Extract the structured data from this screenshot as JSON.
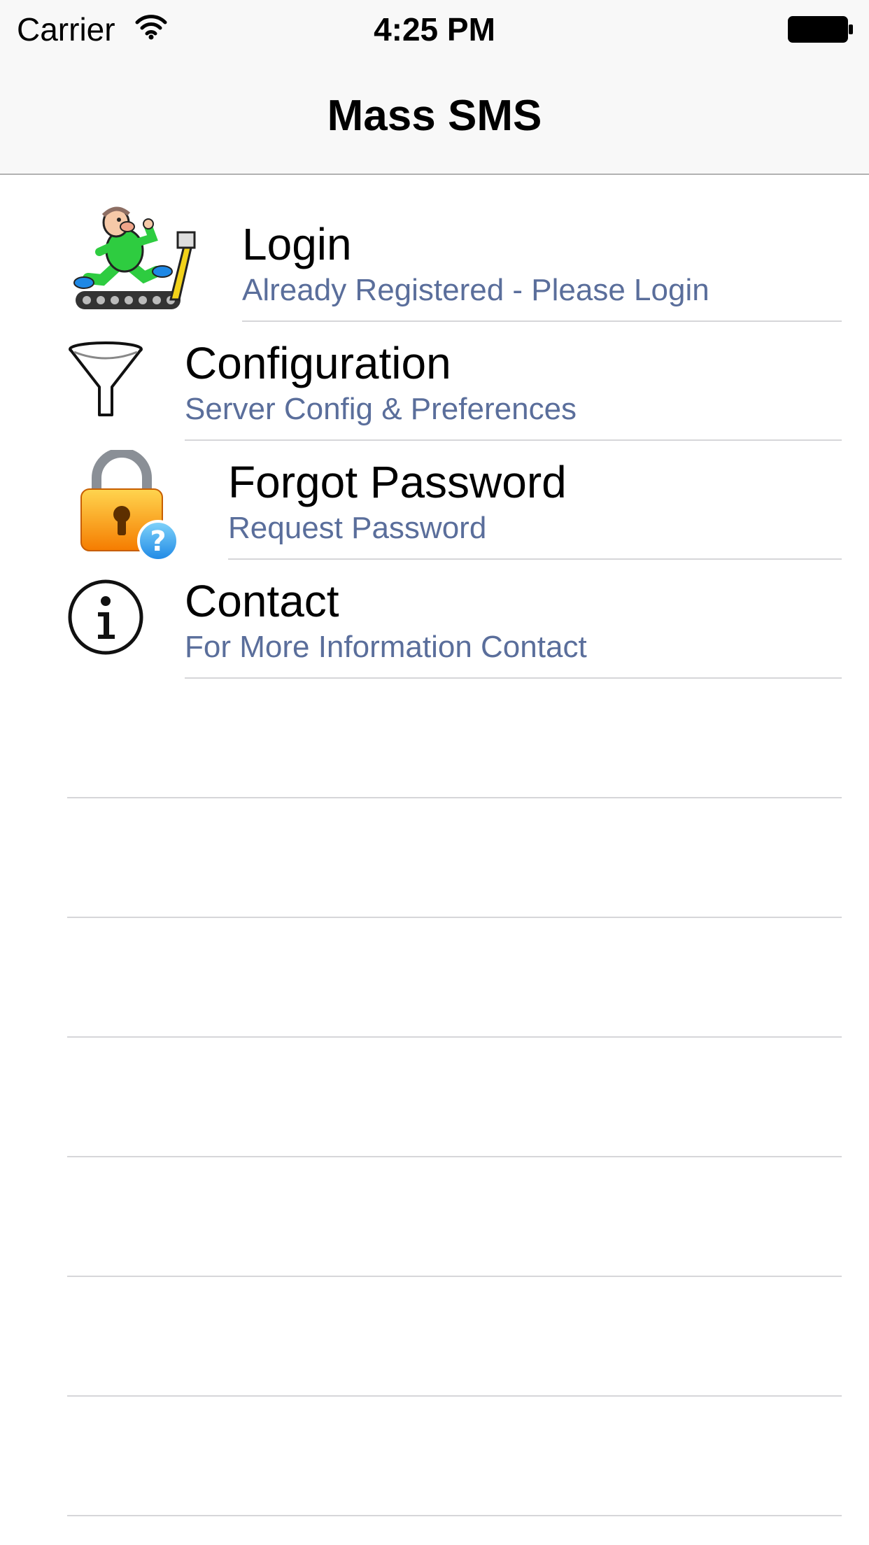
{
  "status_bar": {
    "carrier": "Carrier",
    "time": "4:25 PM",
    "icons": [
      "wifi-icon",
      "battery-icon"
    ]
  },
  "nav": {
    "title": "Mass SMS"
  },
  "menu": {
    "items": [
      {
        "icon": "runner-treadmill-icon",
        "title": "Login",
        "subtitle": "Already Registered - Please Login"
      },
      {
        "icon": "funnel-icon",
        "title": "Configuration",
        "subtitle": "Server Config & Preferences"
      },
      {
        "icon": "padlock-question-icon",
        "title": "Forgot Password",
        "subtitle": "Request Password"
      },
      {
        "icon": "info-icon",
        "title": "Contact",
        "subtitle": "For More Information Contact"
      }
    ]
  },
  "colors": {
    "subtitle": "#5a6e9b",
    "separator": "#d6d6d9",
    "bar_background": "#f8f8f8"
  }
}
